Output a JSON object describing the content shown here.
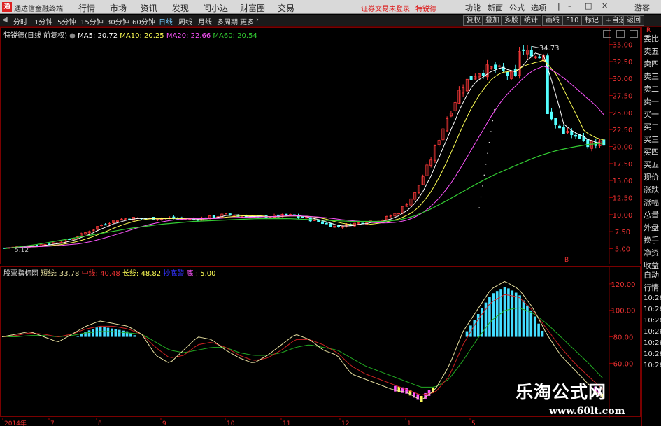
{
  "app_title": "通达信金融终端",
  "menu": [
    "行情",
    "市场",
    "资讯",
    "发现",
    "问小达",
    "财富圈",
    "交易"
  ],
  "notice": "证券交易未登录",
  "stock_link": "特锐德",
  "right_menu": [
    "功能",
    "新面",
    "公式",
    "选项"
  ],
  "guest": "游客",
  "periods": [
    "分时",
    "1分钟",
    "5分钟",
    "15分钟",
    "30分钟",
    "60分钟",
    "日线",
    "周线",
    "月线",
    "多周期",
    "更多"
  ],
  "active_period": "日线",
  "tool_buttons": [
    "复权",
    "叠加",
    "多股",
    "统计",
    "画线",
    "F10",
    "标记",
    "+自选",
    "返回"
  ],
  "main_legend": {
    "stock": "特锐德(日线 前复权)",
    "ma5": "MA5: 20.72",
    "ma10": "MA10: 20.25",
    "ma20": "MA20: 22.66",
    "ma60": "MA60: 20.54"
  },
  "ind_legend": {
    "name": "股票指标网",
    "short": "短线: 33.78",
    "mid": "中线: 40.48",
    "long": "长线: 48.82",
    "bottom_label": "抄底警",
    "di": "底",
    "extra": ": 5.00"
  },
  "colors": {
    "up": "#ff3a3a",
    "down": "#54ffff",
    "ma5": "#ffffff",
    "ma10": "#ffff55",
    "ma20": "#ff55ff",
    "ma60": "#33cc33",
    "short_line": "#e8e0a0",
    "mid_line": "#cc2222",
    "long_line": "#22aa22",
    "bar": "#44ddff"
  },
  "annotations": {
    "high": "34.73",
    "low": "5.12",
    "b_marker": "B"
  },
  "side_items": [
    "委比",
    "卖五",
    "卖四",
    "卖三",
    "卖二",
    "卖一",
    "买一",
    "买二",
    "买三",
    "买四",
    "买五",
    "现价",
    "涨跌",
    "涨幅",
    "总量",
    "外盘",
    "换手",
    "净资",
    "收益",
    "自动",
    "行情",
    "10:26",
    "10:26",
    "10:26",
    "10:26",
    "10:26",
    "10:26",
    "10:26"
  ],
  "side_top": "R",
  "watermark": {
    "cn": "乐淘公式网",
    "url": "www.60lt.com"
  },
  "chart_data": [
    {
      "type": "candlestick",
      "title": "特锐德(日线 前复权)",
      "y_ticks": [
        5.0,
        7.5,
        10.0,
        12.5,
        15.0,
        17.5,
        20.0,
        22.5,
        25.0,
        27.5,
        30.0,
        32.5,
        35.0
      ],
      "y_labels": [
        "5.00",
        "7.50",
        "10.00",
        "12.50",
        "15.00",
        "17.50",
        "20.00",
        "22.50",
        "25.00",
        "27.50",
        "30.00",
        "32.50",
        "35.00"
      ],
      "ylim": [
        3.5,
        36.6
      ],
      "x_labels": [
        "2014年",
        "7",
        "8",
        "9",
        "10",
        "11",
        "12",
        "1",
        "5"
      ],
      "close_series": [
        5.1,
        5.3,
        5.5,
        5.8,
        6.3,
        7.2,
        8.4,
        9.2,
        9.5,
        9.4,
        9.5,
        9.4,
        9.3,
        9.6,
        10.0,
        9.8,
        9.6,
        9.7,
        9.9,
        9.5,
        8.9,
        8.2,
        8.6,
        9.0,
        9.3,
        10.4,
        13.0,
        18.0,
        24.0,
        29.0,
        31.0,
        31.5,
        30.5,
        29.0,
        26.0,
        23.0,
        21.5,
        20.4,
        20.6
      ],
      "ma60_series": [
        5.0,
        5.3,
        5.6,
        6.0,
        6.4,
        6.8,
        7.2,
        7.6,
        8.0,
        8.3,
        8.6,
        8.8,
        9.0,
        9.1,
        9.2,
        9.3,
        9.4,
        9.4,
        9.4,
        9.3,
        9.2,
        9.1,
        9.0,
        9.0,
        9.0,
        9.2,
        9.8,
        10.8,
        12.0,
        13.3,
        14.6,
        15.8,
        16.8,
        17.8,
        18.7,
        19.4,
        19.9,
        20.3,
        20.5
      ],
      "high": 34.73,
      "low": 5.12
    },
    {
      "type": "line",
      "title": "股票指标网",
      "y_ticks": [
        60,
        80,
        100,
        120
      ],
      "y_labels": [
        "60.00",
        "80.00",
        "100.00",
        "120.00"
      ],
      "ylim": [
        20,
        130
      ],
      "series": [
        {
          "name": "短线",
          "last": 33.78
        },
        {
          "name": "中线",
          "last": 40.48
        },
        {
          "name": "长线",
          "last": 48.82
        }
      ],
      "short_series": [
        80,
        82,
        84,
        80,
        76,
        82,
        88,
        92,
        90,
        88,
        82,
        66,
        60,
        70,
        80,
        78,
        70,
        64,
        60,
        66,
        74,
        82,
        78,
        70,
        66,
        52,
        48,
        44,
        40,
        38,
        32,
        40,
        58,
        84,
        100,
        116,
        122,
        116,
        102,
        82,
        66,
        55,
        44,
        33.78
      ],
      "mid_series": [
        80,
        81,
        83,
        82,
        80,
        82,
        86,
        88,
        88,
        86,
        82,
        72,
        64,
        66,
        74,
        76,
        72,
        66,
        62,
        64,
        70,
        78,
        78,
        74,
        68,
        58,
        52,
        48,
        44,
        40,
        36,
        38,
        50,
        74,
        92,
        106,
        112,
        110,
        100,
        86,
        72,
        60,
        50,
        40.48
      ],
      "long_series": [
        80,
        80,
        81,
        81,
        80,
        81,
        83,
        84,
        84,
        83,
        82,
        76,
        70,
        68,
        70,
        72,
        72,
        68,
        66,
        66,
        68,
        72,
        74,
        72,
        70,
        64,
        58,
        54,
        50,
        46,
        42,
        42,
        48,
        62,
        78,
        92,
        100,
        102,
        98,
        90,
        80,
        70,
        60,
        48.82
      ]
    }
  ]
}
